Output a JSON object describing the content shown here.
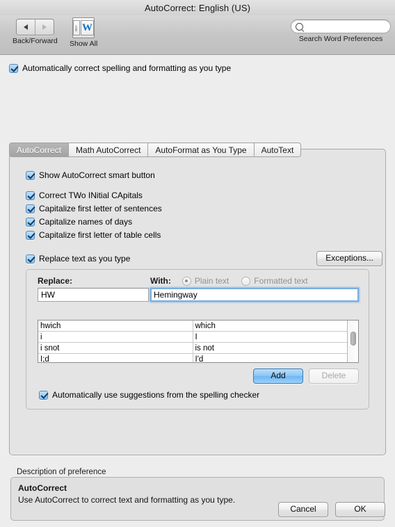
{
  "window": {
    "title": "AutoCorrect: English (US)"
  },
  "toolbar": {
    "back_forward_label": "Back/Forward",
    "back_icon": "triangle-left-icon",
    "forward_icon": "triangle-right-icon",
    "show_all_label": "Show All",
    "show_all_icon": "word-prefs-icon",
    "show_all_letter": "W",
    "search_placeholder": "",
    "search_value": "",
    "search_icon": "search-icon",
    "search_label": "Search Word Preferences"
  },
  "global": {
    "auto_correct_label": "Automatically correct spelling and formatting as you type",
    "auto_correct_checked": true
  },
  "tabs": [
    {
      "label": "AutoCorrect",
      "active": true
    },
    {
      "label": "Math AutoCorrect",
      "active": false
    },
    {
      "label": "AutoFormat as You Type",
      "active": false
    },
    {
      "label": "AutoText",
      "active": false
    }
  ],
  "panel": {
    "smart_button": {
      "label": "Show AutoCorrect smart button",
      "checked": true
    },
    "options": [
      {
        "label": "Correct TWo INitial CApitals",
        "checked": true
      },
      {
        "label": "Capitalize first letter of sentences",
        "checked": true
      },
      {
        "label": "Capitalize names of days",
        "checked": true
      },
      {
        "label": "Capitalize first letter of table cells",
        "checked": true
      }
    ],
    "replace_text": {
      "label": "Replace text as you type",
      "checked": true
    },
    "exceptions_button": "Exceptions...",
    "replace_field": {
      "label": "Replace:",
      "value": "HW"
    },
    "with_field": {
      "label": "With:",
      "value": "Hemingway"
    },
    "format_radios": [
      {
        "label": "Plain text",
        "selected": true,
        "disabled": true
      },
      {
        "label": "Formatted text",
        "selected": false,
        "disabled": true
      }
    ],
    "table": {
      "rows": [
        {
          "replace": "hwich",
          "with": "which"
        },
        {
          "replace": "i",
          "with": "I"
        },
        {
          "replace": "i snot",
          "with": "is not"
        },
        {
          "replace": "I;d",
          "with": "I'd"
        }
      ]
    },
    "add_button": "Add",
    "delete_button": "Delete",
    "delete_disabled": true,
    "spell_checker": {
      "label": "Automatically use suggestions from the spelling checker",
      "checked": true
    }
  },
  "description": {
    "section_label": "Description of preference",
    "heading": "AutoCorrect",
    "text": "Use AutoCorrect to correct text and formatting as you type."
  },
  "footer": {
    "cancel_button": "Cancel",
    "ok_button": "OK"
  },
  "colors": {
    "accent": "#6fb7f3",
    "window_bg": "#ededed",
    "panel_bg": "#e4e4e4",
    "focus_ring": "#7aaedd"
  }
}
